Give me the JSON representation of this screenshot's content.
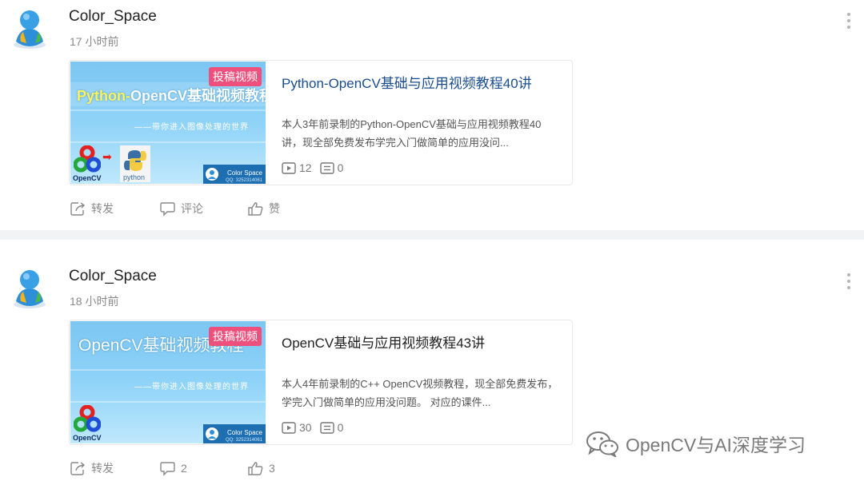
{
  "posts": [
    {
      "username": "Color_Space",
      "time": "17 小时前",
      "card": {
        "title": "Python-OpenCV基础与应用视频教程40讲",
        "description": "本人3年前录制的Python-OpenCV基础与应用视频教程40讲，现全部免费发布学完入门做简单的应用没问...",
        "plays": "12",
        "comments": "0",
        "thumb": {
          "badge": "投稿视频",
          "title_prefix": "Python-",
          "title_main": "OpenCV基础视频教程",
          "tagline": "——带你进入图像处理的世界",
          "cv_label": "OpenCV",
          "py_label": "python",
          "brand": "Color Space",
          "qq": "QQ: 3252314061"
        }
      },
      "actions": {
        "repost": "转发",
        "comment": "评论",
        "like": "赞"
      }
    },
    {
      "username": "Color_Space",
      "time": "18 小时前",
      "card": {
        "title": "OpenCV基础与应用视频教程43讲",
        "description": "本人4年前录制的C++ OpenCV视频教程，现全部免费发布，学完入门做简单的应用没问题。 对应的课件...",
        "plays": "30",
        "comments": "0",
        "thumb": {
          "badge": "投稿视频",
          "title_main": "OpenCV基础视频教程",
          "tagline": "——带你进入图像处理的世界",
          "cv_label": "OpenCV",
          "brand": "Color Space",
          "qq": "QQ: 3252314061"
        }
      },
      "actions": {
        "repost": "转发",
        "comment": "2",
        "like": "3"
      }
    }
  ],
  "watermark": "OpenCV与AI深度学习",
  "colors": {
    "title_link": "#1a4d8f",
    "badge": "#ee4f7d",
    "meta_gray": "#8a8a8a"
  },
  "icons": [
    "avatar-icon",
    "more-icon",
    "play-icon",
    "comment-count-icon",
    "repost-icon",
    "comment-icon",
    "like-icon",
    "wechat-icon"
  ]
}
